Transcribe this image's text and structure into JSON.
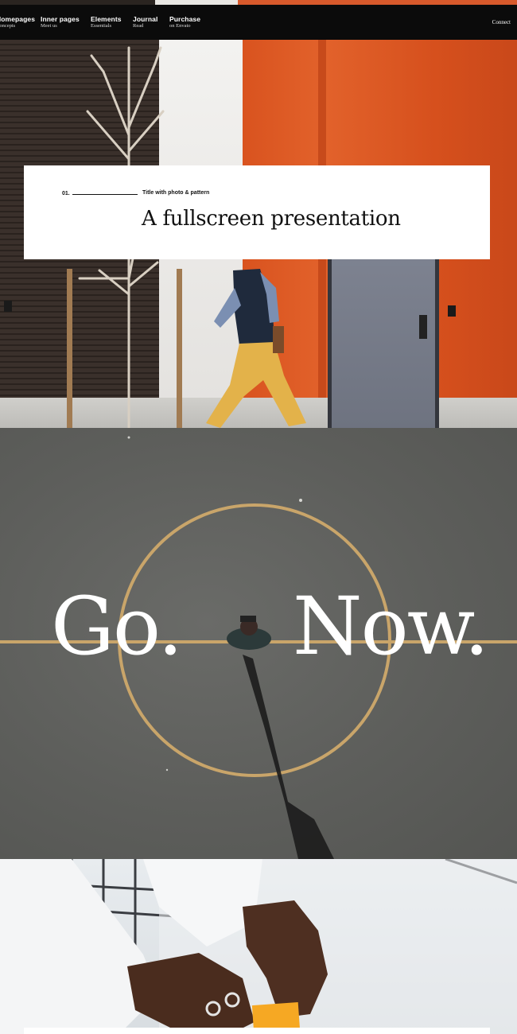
{
  "nav": {
    "items": [
      {
        "label": "Homepages",
        "sub": "Concepts"
      },
      {
        "label": "Inner pages",
        "sub": "Meet us"
      },
      {
        "label": "Elements",
        "sub": "Essentials"
      },
      {
        "label": "Journal",
        "sub": "Read"
      },
      {
        "label": "Purchase",
        "sub": "on Envato"
      }
    ],
    "connect": "Connect"
  },
  "title_card": {
    "number": "01.",
    "kicker": "Title with photo & pattern",
    "headline": "A fullscreen presentation"
  },
  "hero": {
    "word1": "Go.",
    "word2": "Now."
  },
  "colors": {
    "nav_bg": "#0b0b0b",
    "orange_wall": "#e2622b",
    "court_gray": "#5d5e5b",
    "court_line": "#c9a56a",
    "card_bg": "#ffffff"
  }
}
